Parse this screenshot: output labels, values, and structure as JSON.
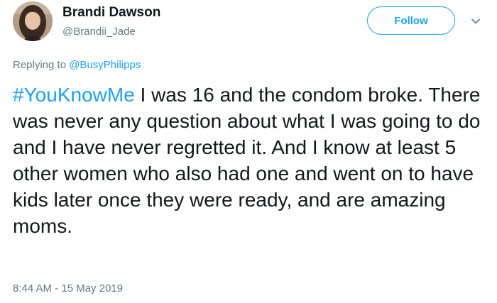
{
  "author": {
    "display_name": "Brandi Dawson",
    "handle": "@Brandii_Jade",
    "avatar_icon": "profile-photo"
  },
  "actions": {
    "follow_label": "Follow",
    "menu_icon": "chevron-down-icon"
  },
  "reply": {
    "prefix": "Replying to ",
    "mention": "@BusyPhilipps"
  },
  "tweet": {
    "hashtag": "#YouKnowMe",
    "body": " I was 16 and the condom broke. There was never any question about what I was going to do and I have never regretted it. And I know at least 5 other women who also had one and went on to have kids later once they were ready, and are amazing moms."
  },
  "meta": {
    "timestamp": "8:44 AM - 15 May 2019"
  },
  "colors": {
    "accent": "#1da1f2",
    "text": "#14171a",
    "muted": "#657786"
  }
}
